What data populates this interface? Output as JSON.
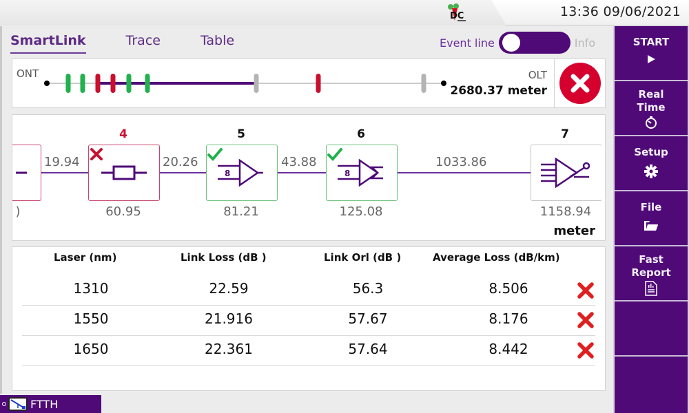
{
  "status_bar": {
    "logo_icon": "dc-logo-icon",
    "time": "13:36",
    "date": "09/06/2021"
  },
  "tabs": [
    {
      "label": "SmartLink",
      "active": true
    },
    {
      "label": "Trace",
      "active": false
    },
    {
      "label": "Table",
      "active": false
    }
  ],
  "event_toggle": {
    "label": "Event line",
    "off_label": "Info",
    "state": "Event line"
  },
  "overview": {
    "start_label": "ONT",
    "end_label": "OLT",
    "total_distance": "2680.37 meter",
    "result_status": "fail",
    "colors": {
      "pass": "#22b14c",
      "fail": "#c8102e",
      "neutral": "#b4b4b4",
      "fiber": "#4f0a78",
      "base": "#cccccc"
    },
    "events": [
      {
        "status": "pass"
      },
      {
        "status": "pass"
      },
      {
        "status": "fail"
      },
      {
        "status": "fail"
      },
      {
        "status": "pass"
      },
      {
        "status": "pass"
      },
      {
        "status": "neutral"
      },
      {
        "status": "fail"
      },
      {
        "status": "neutral"
      }
    ]
  },
  "schematic": {
    "unit": "meter",
    "elements": [
      {
        "number": "",
        "position": ")",
        "status": "fail",
        "type": "connector-partial"
      },
      {
        "number": "4",
        "position": "60.95",
        "status": "fail",
        "type": "connector"
      },
      {
        "number": "5",
        "position": "81.21",
        "status": "pass",
        "type": "splitter-1x8"
      },
      {
        "number": "6",
        "position": "125.08",
        "status": "pass",
        "type": "splitter-1x8-sum"
      },
      {
        "number": "7",
        "position": "1158.94",
        "status": "neutral",
        "type": "olt"
      }
    ],
    "segments": [
      "19.94",
      "20.26",
      "43.88",
      "1033.86"
    ]
  },
  "results": {
    "headers": [
      "Laser (nm)",
      "Link Loss (dB )",
      "Link Orl (dB )",
      "Average Loss (dB/km)"
    ],
    "rows": [
      {
        "laser": "1310",
        "link_loss": "22.59",
        "link_orl": "56.3",
        "avg_loss": "8.506",
        "status": "fail"
      },
      {
        "laser": "1550",
        "link_loss": "21.916",
        "link_orl": "57.67",
        "avg_loss": "8.176",
        "status": "fail"
      },
      {
        "laser": "1650",
        "link_loss": "22.361",
        "link_orl": "57.64",
        "avg_loss": "8.442",
        "status": "fail"
      }
    ]
  },
  "sidebar": {
    "buttons": [
      {
        "label": "START",
        "icon": "play-icon"
      },
      {
        "label": "Real Time",
        "icon": "stopwatch-icon"
      },
      {
        "label": "Setup",
        "icon": "gear-icon"
      },
      {
        "label": "File",
        "icon": "folder-icon"
      },
      {
        "label": "Fast Report",
        "icon": "report-icon"
      },
      {
        "label": "",
        "icon": ""
      },
      {
        "label": "",
        "icon": ""
      }
    ]
  },
  "mode": {
    "label": "FTTH",
    "icon": "ftth-icon"
  }
}
